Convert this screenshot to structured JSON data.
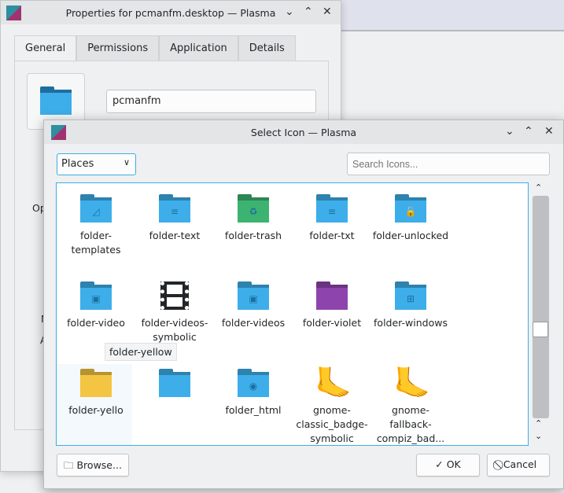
{
  "properties_window": {
    "title": "Properties for pcmanfm.desktop — Plasma",
    "tabs": [
      {
        "label": "General",
        "active": true
      },
      {
        "label": "Permissions"
      },
      {
        "label": "Application"
      },
      {
        "label": "Details"
      }
    ],
    "name_value": "pcmanfm",
    "obscured_labels": [
      "Op",
      "N",
      "A"
    ]
  },
  "dialog": {
    "title": "Select Icon — Plasma",
    "category": "Places",
    "search_placeholder": "Search Icons...",
    "icons": [
      {
        "label": "folder-templates",
        "glyph": "◿",
        "color": "#3daee9"
      },
      {
        "label": "folder-text",
        "glyph": "≡",
        "color": "#3daee9"
      },
      {
        "label": "folder-trash",
        "glyph": "♻",
        "color": "#3cb371"
      },
      {
        "label": "folder-txt",
        "glyph": "≡",
        "color": "#3daee9"
      },
      {
        "label": "folder-unlocked",
        "glyph": "🔓",
        "color": "#3daee9"
      },
      {
        "label": "folder-video",
        "glyph": "▣",
        "color": "#3daee9"
      },
      {
        "label": "folder-videos-symbolic",
        "glyph": "film",
        "color": "#232629"
      },
      {
        "label": "folder-videos",
        "glyph": "▣",
        "color": "#3daee9"
      },
      {
        "label": "folder-violet",
        "glyph": "",
        "color": "#8e44ad"
      },
      {
        "label": "folder-windows",
        "glyph": "⊞",
        "color": "#3daee9"
      },
      {
        "label": "folder-yellow",
        "glyph": "",
        "color": "#f4c542"
      },
      {
        "label": "",
        "glyph": "",
        "color": "#3daee9"
      },
      {
        "label": "folder_html",
        "glyph": "◉",
        "color": "#3daee9"
      },
      {
        "label": "gnome-classic_badge-symbolic",
        "glyph": "foot",
        "color": "#b0b0b0"
      },
      {
        "label": "gnome-fallback-compiz_bad...",
        "glyph": "foot",
        "color": "#b0b0b0"
      }
    ],
    "first_cell_label_truncated": "folder-yello",
    "tooltip": "folder-yellow",
    "browse_label": "Browse...",
    "ok_label": "OK",
    "cancel_label": "Cancel",
    "accent": "#3daee9"
  }
}
